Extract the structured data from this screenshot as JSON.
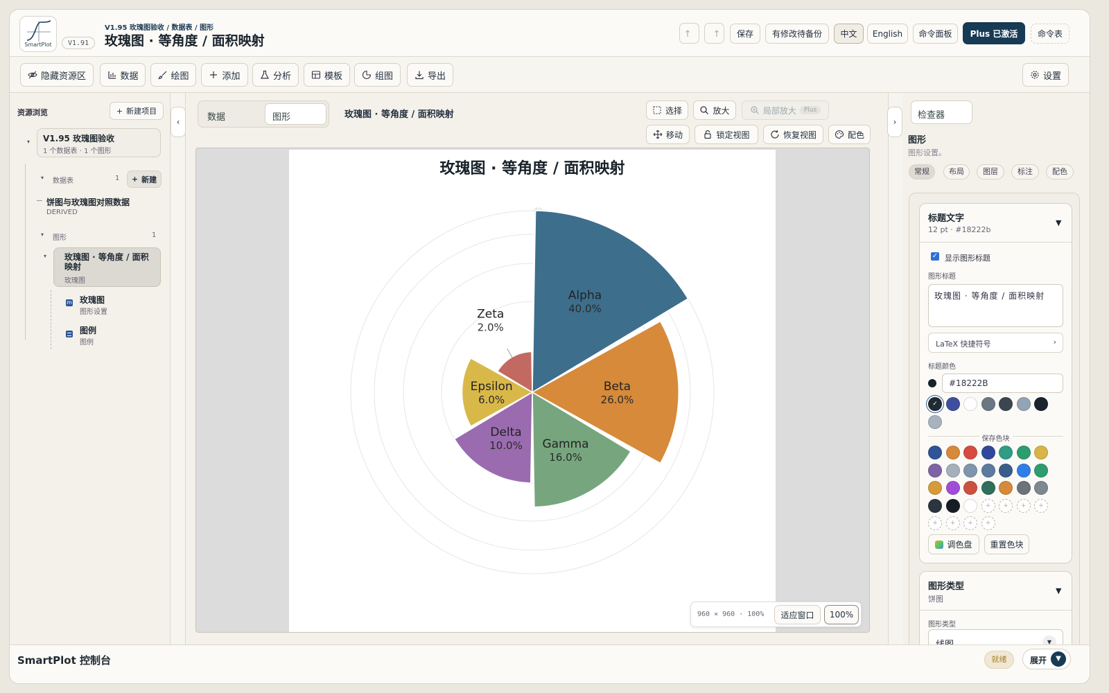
{
  "header": {
    "logo_label": "SmartPlot",
    "version": "V1.91",
    "breadcrumb": "V1.95 玫瑰图验收 / 数据表 / 图形",
    "page_title": "玫瑰图 · 等角度 / 面积映射",
    "save": "保存",
    "pending_backup": "有修改待备份",
    "lang_zh": "中文",
    "lang_en": "English",
    "command_panel": "命令面板",
    "plus": "Plus 已激活",
    "command_table": "命令表"
  },
  "toolbar": {
    "hide_resources": "隐藏资源区",
    "data": "数据",
    "draw": "绘图",
    "add": "添加",
    "analysis": "分析",
    "template": "模板",
    "group": "组图",
    "export": "导出",
    "settings": "设置"
  },
  "sidebar": {
    "title": "资源浏览",
    "new_project": "新建项目",
    "project_name": "V1.95 玫瑰图验收",
    "project_meta": "1 个数据表 · 1 个图形",
    "datasets_label": "数据表",
    "datasets_count": "1",
    "new_btn": "新建",
    "dataset_name": "饼图与玫瑰图对照数据",
    "dataset_tag": "DERIVED",
    "figures_label": "图形",
    "figures_count": "1",
    "figure_name": "玫瑰图 · 等角度 / 面积映射",
    "figure_type": "玫瑰图",
    "child1_name": "玫瑰图",
    "child1_desc": "图形设置",
    "child2_name": "图例",
    "child2_desc": "图例"
  },
  "canvas": {
    "tab_data": "数据",
    "tab_figure": "图形",
    "title": "玫瑰图 · 等角度 / 面积映射",
    "select": "选择",
    "zoom_in": "放大",
    "local_zoom": "局部放大",
    "plus_badge": "Plus",
    "move": "移动",
    "lock_view": "锁定视图",
    "reset_view": "恢复视图",
    "color": "配色",
    "size_info": "960 × 960 · 100%",
    "fit_window": "适应窗口",
    "zoom_level": "100%"
  },
  "chart_data": {
    "type": "pie",
    "variant": "rose",
    "title": "玫瑰图 · 等角度 / 面积映射",
    "categories": [
      "Alpha",
      "Beta",
      "Gamma",
      "Delta",
      "Epsilon",
      "Zeta"
    ],
    "values": [
      40.0,
      26.0,
      16.0,
      10.0,
      6.0,
      2.0
    ],
    "value_labels": [
      "40.0%",
      "26.0%",
      "16.0%",
      "10.0%",
      "6.0%",
      "2.0%"
    ],
    "colors": [
      "#3d6e8c",
      "#d68a3a",
      "#77a67e",
      "#9b6bb0",
      "#d9b84a",
      "#c26a62"
    ],
    "radius_tick_label": "40"
  },
  "inspector": {
    "tab": "检查器",
    "section": "图形",
    "section_desc": "图形设置。",
    "tabs": [
      "常规",
      "布局",
      "图层",
      "标注",
      "配色"
    ],
    "title_text_label": "标题文字",
    "title_text_meta": "12 pt · #18222b",
    "show_title": "显示图形标题",
    "figure_title_label": "图形标题",
    "figure_title_value": "玫瑰图 · 等角度 / 面积映射",
    "latex": "LaTeX 快捷符号",
    "title_color_label": "标题颜色",
    "title_color_value": "#18222B",
    "recent_colors": [
      "#1f2a33",
      "#3e4f9e",
      "#ffffff",
      "#6b7884",
      "#3b4650",
      "#93a4b4",
      "#1a242e",
      "#a8b3be"
    ],
    "saved_swatches_label": "保存色块",
    "saved_colors": [
      "#2f5597",
      "#d68a3a",
      "#d64a42",
      "#30489c",
      "#2e9d83",
      "#2e9d6e",
      "#d9b446",
      "#7e63a6",
      "#a5b0ba",
      "#7f95ad",
      "#5c7b9e",
      "#3a5e8c",
      "#2f7ee8",
      "#2e9d6e",
      "#d69a3a",
      "#a04ed8",
      "#cc5040",
      "#2f6e5a",
      "#d68a3a",
      "#6c7379",
      "#7d8890",
      "#2a3540",
      "#161d25",
      "#ffffff"
    ],
    "palette_btn": "调色盘",
    "reset_btn": "重置色块",
    "figure_type_label": "图形类型",
    "figure_type_meta": "饼图",
    "figure_type_field_label": "图形类型",
    "figure_type_value": "线图"
  },
  "status": {
    "app_title": "SmartPlot 控制台",
    "ready": "就绪",
    "expand": "展开"
  }
}
